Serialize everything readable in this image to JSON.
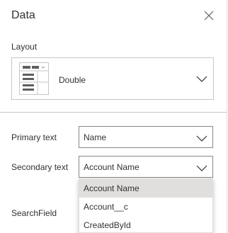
{
  "panel": {
    "title": "Data",
    "close_icon": "close-icon"
  },
  "layout": {
    "label": "Layout",
    "value": "Double"
  },
  "primary_text": {
    "label": "Primary text",
    "value": "Name"
  },
  "secondary_text": {
    "label": "Secondary text",
    "value": "Account Name"
  },
  "search_field": {
    "label": "SearchField"
  },
  "dropdown": {
    "options": [
      "Account Name",
      "Account__c",
      "CreatedById"
    ],
    "highlighted": "Account Name"
  },
  "colors": {
    "border": "#8a8886",
    "highlight": "#e1dfdd",
    "text": "#323130"
  }
}
